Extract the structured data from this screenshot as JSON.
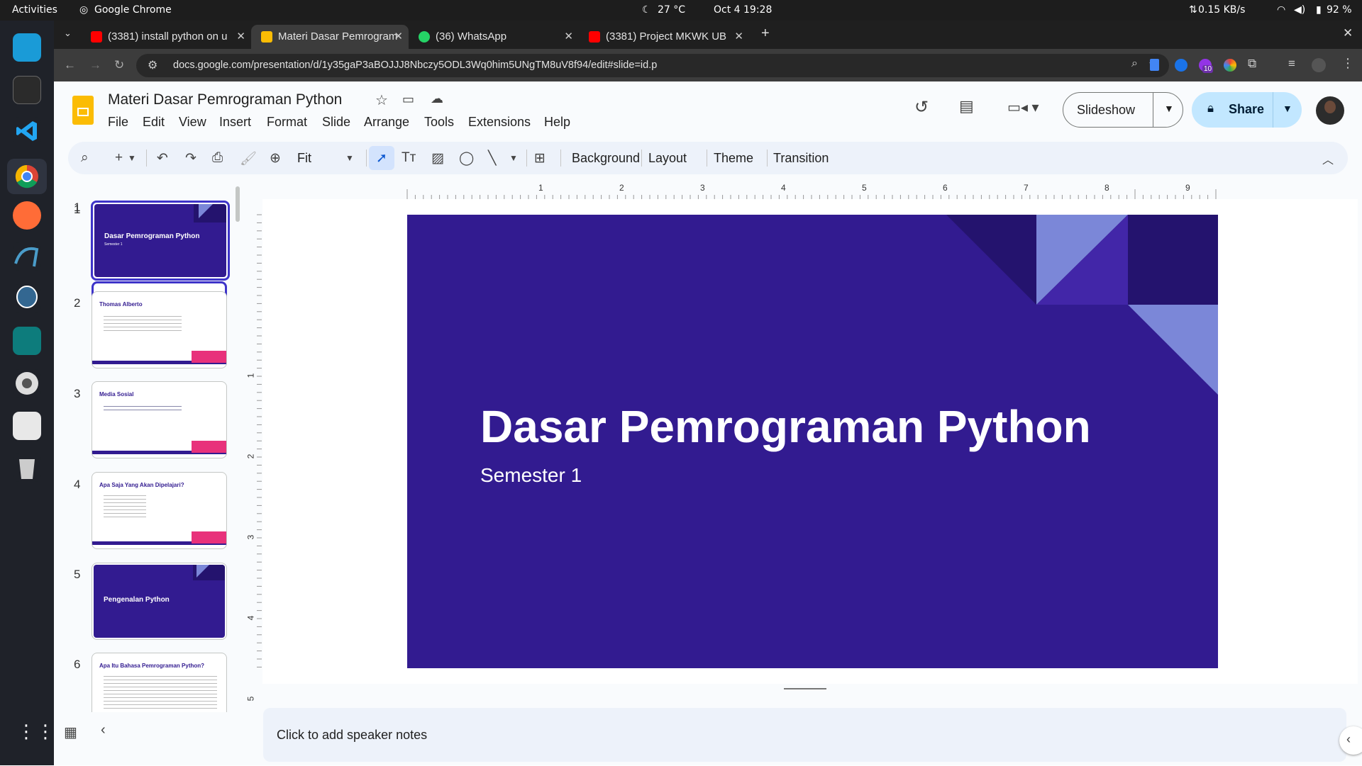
{
  "system": {
    "activities": "Activities",
    "app_name": "Google Chrome",
    "weather": "27 °C",
    "datetime": "Oct 4  19:28",
    "net_speed": "0.15 KB/s",
    "battery": "92 %"
  },
  "browser": {
    "tabs": [
      {
        "title": "(3381) install python on u",
        "favicon_color": "#ff0000"
      },
      {
        "title": "Materi Dasar Pemrogram",
        "favicon_color": "#fbbc04"
      },
      {
        "title": "(36) WhatsApp",
        "favicon_color": "#25d366"
      },
      {
        "title": "(3381) Project MKWK UB",
        "favicon_color": "#ff0000"
      }
    ],
    "url": "docs.google.com/presentation/d/1y35gaP3aBOJJJ8Nbczy5ODL3Wq0him5UNgTM8uV8f94/edit#slide=id.p",
    "extension_badge": "10"
  },
  "doc": {
    "title": "Materi Dasar Pemrograman Python",
    "menu": [
      "File",
      "Edit",
      "View",
      "Insert",
      "Format",
      "Slide",
      "Arrange",
      "Tools",
      "Extensions",
      "Help"
    ],
    "slideshow_label": "Slideshow",
    "share_label": "Share"
  },
  "toolbar": {
    "zoom": "Fit",
    "background": "Background",
    "layout": "Layout",
    "theme": "Theme",
    "transition": "Transition"
  },
  "ruler": {
    "h_ticks": [
      "1",
      "2",
      "3",
      "4",
      "5",
      "6",
      "7",
      "8",
      "9"
    ],
    "v_ticks": [
      "1",
      "2",
      "3",
      "4",
      "5"
    ]
  },
  "slides": [
    {
      "num": "1",
      "title": "Dasar Pemrograman Python",
      "subtitle": "Semester 1"
    },
    {
      "num": "2",
      "title": "Thomas Alberto"
    },
    {
      "num": "3",
      "title": "Media Sosial"
    },
    {
      "num": "4",
      "title": "Apa Saja Yang Akan Dipelajari?"
    },
    {
      "num": "5",
      "title": "Pengenalan Python"
    },
    {
      "num": "6",
      "title": "Apa Itu Bahasa Pemrograman Python?"
    }
  ],
  "main_slide": {
    "title": "Dasar Pemrograman Python",
    "subtitle": "Semester 1"
  },
  "notes": {
    "placeholder": "Click to add speaker notes"
  },
  "colors": {
    "slide_bg": "#321b90",
    "accent_light": "#7b87d8",
    "accent_dark": "#24136e",
    "pink": "#e8317b",
    "share_bg": "#c2e7ff"
  }
}
